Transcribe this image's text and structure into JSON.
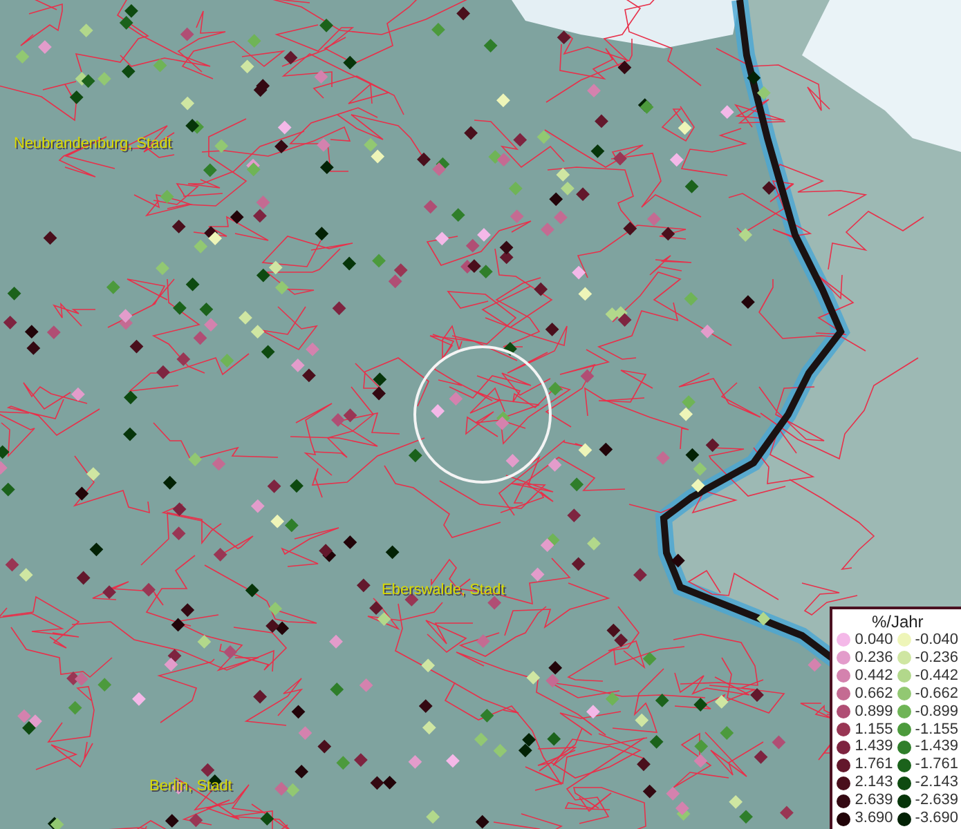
{
  "map": {
    "city_labels": [
      {
        "name": "Neubrandenburg, Stadt"
      },
      {
        "name": "Eberswalde, Stadt"
      },
      {
        "name": "Berlin, Stadt"
      }
    ]
  },
  "legend": {
    "title": "%/Jahr",
    "positive": [
      {
        "label": "0.040",
        "color": "#f4b8e8"
      },
      {
        "label": "0.236",
        "color": "#e39ccb"
      },
      {
        "label": "0.442",
        "color": "#d482ae"
      },
      {
        "label": "0.662",
        "color": "#c46b92"
      },
      {
        "label": "0.899",
        "color": "#b04e74"
      },
      {
        "label": "1.155",
        "color": "#993654"
      },
      {
        "label": "1.439",
        "color": "#7e2440"
      },
      {
        "label": "1.761",
        "color": "#63182c"
      },
      {
        "label": "2.143",
        "color": "#4a0f1c"
      },
      {
        "label": "2.639",
        "color": "#340912"
      },
      {
        "label": "3.690",
        "color": "#220409"
      }
    ],
    "negative": [
      {
        "label": "-0.040",
        "color": "#eef5b8"
      },
      {
        "label": "-0.236",
        "color": "#cfe6a2"
      },
      {
        "label": "-0.442",
        "color": "#b2d88b"
      },
      {
        "label": "-0.662",
        "color": "#92c872"
      },
      {
        "label": "-0.899",
        "color": "#6fb456"
      },
      {
        "label": "-1.155",
        "color": "#4c9a3c"
      },
      {
        "label": "-1.439",
        "color": "#2f7e2a"
      },
      {
        "label": "-1.761",
        "color": "#1b621b"
      },
      {
        "label": "-2.143",
        "color": "#0e4a10"
      },
      {
        "label": "-2.639",
        "color": "#07350a"
      },
      {
        "label": "-3.690",
        "color": "#032205"
      }
    ]
  }
}
